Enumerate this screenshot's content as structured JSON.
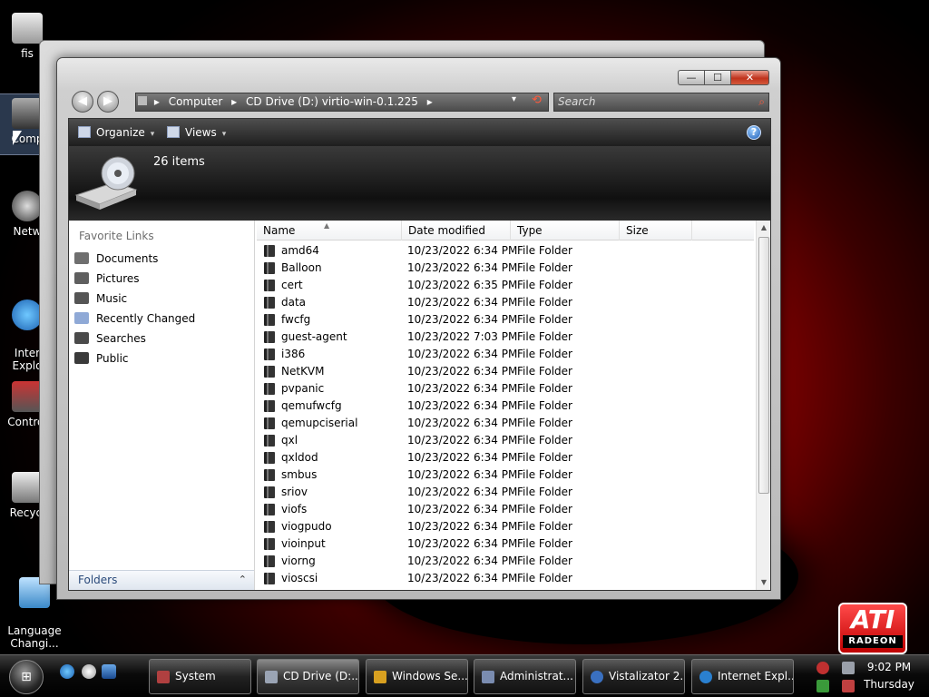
{
  "desktop": {
    "icons": [
      {
        "label": "fis",
        "icon": "folder-icon"
      },
      {
        "label": "Comp",
        "icon": "computer-icon"
      },
      {
        "label": "Netw",
        "icon": "network-icon"
      },
      {
        "label": "Inter\nExplo",
        "icon": "internet-explorer-icon"
      },
      {
        "label": "Control",
        "icon": "control-panel-icon"
      },
      {
        "label": "Recycl",
        "icon": "recycle-bin-icon"
      },
      {
        "label": "Language\nChangi...",
        "icon": "language-changer-icon"
      }
    ]
  },
  "window": {
    "caption_buttons": {
      "minimize": "—",
      "maximize": "☐",
      "close": "✕"
    },
    "address": {
      "segments": [
        "Computer",
        "CD Drive (D:) virtio-win-0.1.225"
      ],
      "separator": "▸"
    },
    "search": {
      "placeholder": "Search"
    },
    "toolbar": {
      "organize": "Organize",
      "views": "Views",
      "dropdown_glyph": "▾",
      "help": "?"
    },
    "details": {
      "item_count": "26 items"
    },
    "nav_pane": {
      "title": "Favorite Links",
      "items": [
        {
          "label": "Documents",
          "color": "#6f6f6f"
        },
        {
          "label": "Pictures",
          "color": "#5f5f5f"
        },
        {
          "label": "Music",
          "color": "#555555"
        },
        {
          "label": "Recently Changed",
          "color": "#8fa9d6"
        },
        {
          "label": "Searches",
          "color": "#4a4a4a"
        },
        {
          "label": "Public",
          "color": "#3a3a3a"
        }
      ],
      "folders_label": "Folders",
      "folders_chevron": "⌃"
    },
    "columns": {
      "name": "Name",
      "date": "Date modified",
      "type": "Type",
      "size": "Size"
    },
    "files": [
      {
        "name": "amd64",
        "date": "10/23/2022 6:34 PM",
        "type": "File Folder"
      },
      {
        "name": "Balloon",
        "date": "10/23/2022 6:34 PM",
        "type": "File Folder"
      },
      {
        "name": "cert",
        "date": "10/23/2022 6:35 PM",
        "type": "File Folder"
      },
      {
        "name": "data",
        "date": "10/23/2022 6:34 PM",
        "type": "File Folder"
      },
      {
        "name": "fwcfg",
        "date": "10/23/2022 6:34 PM",
        "type": "File Folder"
      },
      {
        "name": "guest-agent",
        "date": "10/23/2022 7:03 PM",
        "type": "File Folder"
      },
      {
        "name": "i386",
        "date": "10/23/2022 6:34 PM",
        "type": "File Folder"
      },
      {
        "name": "NetKVM",
        "date": "10/23/2022 6:34 PM",
        "type": "File Folder"
      },
      {
        "name": "pvpanic",
        "date": "10/23/2022 6:34 PM",
        "type": "File Folder"
      },
      {
        "name": "qemufwcfg",
        "date": "10/23/2022 6:34 PM",
        "type": "File Folder"
      },
      {
        "name": "qemupciserial",
        "date": "10/23/2022 6:34 PM",
        "type": "File Folder"
      },
      {
        "name": "qxl",
        "date": "10/23/2022 6:34 PM",
        "type": "File Folder"
      },
      {
        "name": "qxldod",
        "date": "10/23/2022 6:34 PM",
        "type": "File Folder"
      },
      {
        "name": "smbus",
        "date": "10/23/2022 6:34 PM",
        "type": "File Folder"
      },
      {
        "name": "sriov",
        "date": "10/23/2022 6:34 PM",
        "type": "File Folder"
      },
      {
        "name": "viofs",
        "date": "10/23/2022 6:34 PM",
        "type": "File Folder"
      },
      {
        "name": "viogpudo",
        "date": "10/23/2022 6:34 PM",
        "type": "File Folder"
      },
      {
        "name": "vioinput",
        "date": "10/23/2022 6:34 PM",
        "type": "File Folder"
      },
      {
        "name": "viorng",
        "date": "10/23/2022 6:34 PM",
        "type": "File Folder"
      },
      {
        "name": "vioscsi",
        "date": "10/23/2022 6:34 PM",
        "type": "File Folder"
      }
    ]
  },
  "taskbar": {
    "start_glyph": "⊞",
    "buttons": [
      {
        "label": "System",
        "color": "#b04040",
        "active": false
      },
      {
        "label": "CD Drive (D:...",
        "color": "#9aa4b4",
        "active": true
      },
      {
        "label": "Windows Se...",
        "color": "#d8a020",
        "active": false
      },
      {
        "label": "Administrat...",
        "color": "#7a8cb0",
        "active": false
      },
      {
        "label": "Vistalizator 2...",
        "color": "#3a70c0",
        "active": false
      },
      {
        "label": "Internet Expl...",
        "color": "#2a80d0",
        "active": false
      }
    ],
    "clock": {
      "time": "9:02 PM",
      "day": "Thursday"
    }
  },
  "branding": {
    "ati_logo": "ATI",
    "ati_sub": "RADEON"
  },
  "colors": {
    "accent": "#c40000",
    "close_button": "#c0321c"
  }
}
